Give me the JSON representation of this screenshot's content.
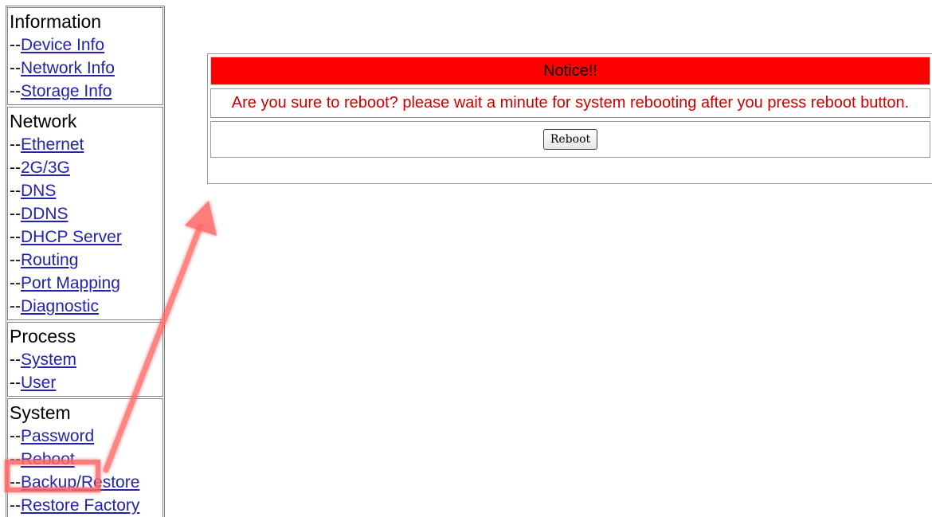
{
  "sidebar": {
    "sections": [
      {
        "title": "Information",
        "items": [
          {
            "dash": "--",
            "label": "Device Info"
          },
          {
            "dash": "--",
            "label": "Network Info"
          },
          {
            "dash": "--",
            "label": "Storage Info"
          }
        ]
      },
      {
        "title": "Network",
        "items": [
          {
            "dash": "--",
            "label": "Ethernet"
          },
          {
            "dash": "--",
            "label": "2G/3G"
          },
          {
            "dash": "--",
            "label": "DNS"
          },
          {
            "dash": "--",
            "label": "DDNS"
          },
          {
            "dash": "--",
            "label": "DHCP Server"
          },
          {
            "dash": "--",
            "label": "Routing"
          },
          {
            "dash": "--",
            "label": "Port Mapping"
          },
          {
            "dash": "--",
            "label": "Diagnostic"
          }
        ]
      },
      {
        "title": "Process",
        "items": [
          {
            "dash": "--",
            "label": "System"
          },
          {
            "dash": "--",
            "label": "User"
          }
        ]
      },
      {
        "title": "System",
        "items": [
          {
            "dash": "--",
            "label": "Password"
          },
          {
            "dash": "--",
            "label": "Reboot"
          },
          {
            "dash": "--",
            "label": "Backup/Restore"
          },
          {
            "dash": "--",
            "label": "Restore Factory"
          }
        ]
      }
    ]
  },
  "notice": {
    "header": "Notice!!",
    "message": "Are you sure to reboot? please wait a minute for system rebooting after you press reboot button.",
    "button_label": "Reboot"
  },
  "annotation": {
    "color": "#ff6666",
    "highlight_target": "Reboot"
  }
}
